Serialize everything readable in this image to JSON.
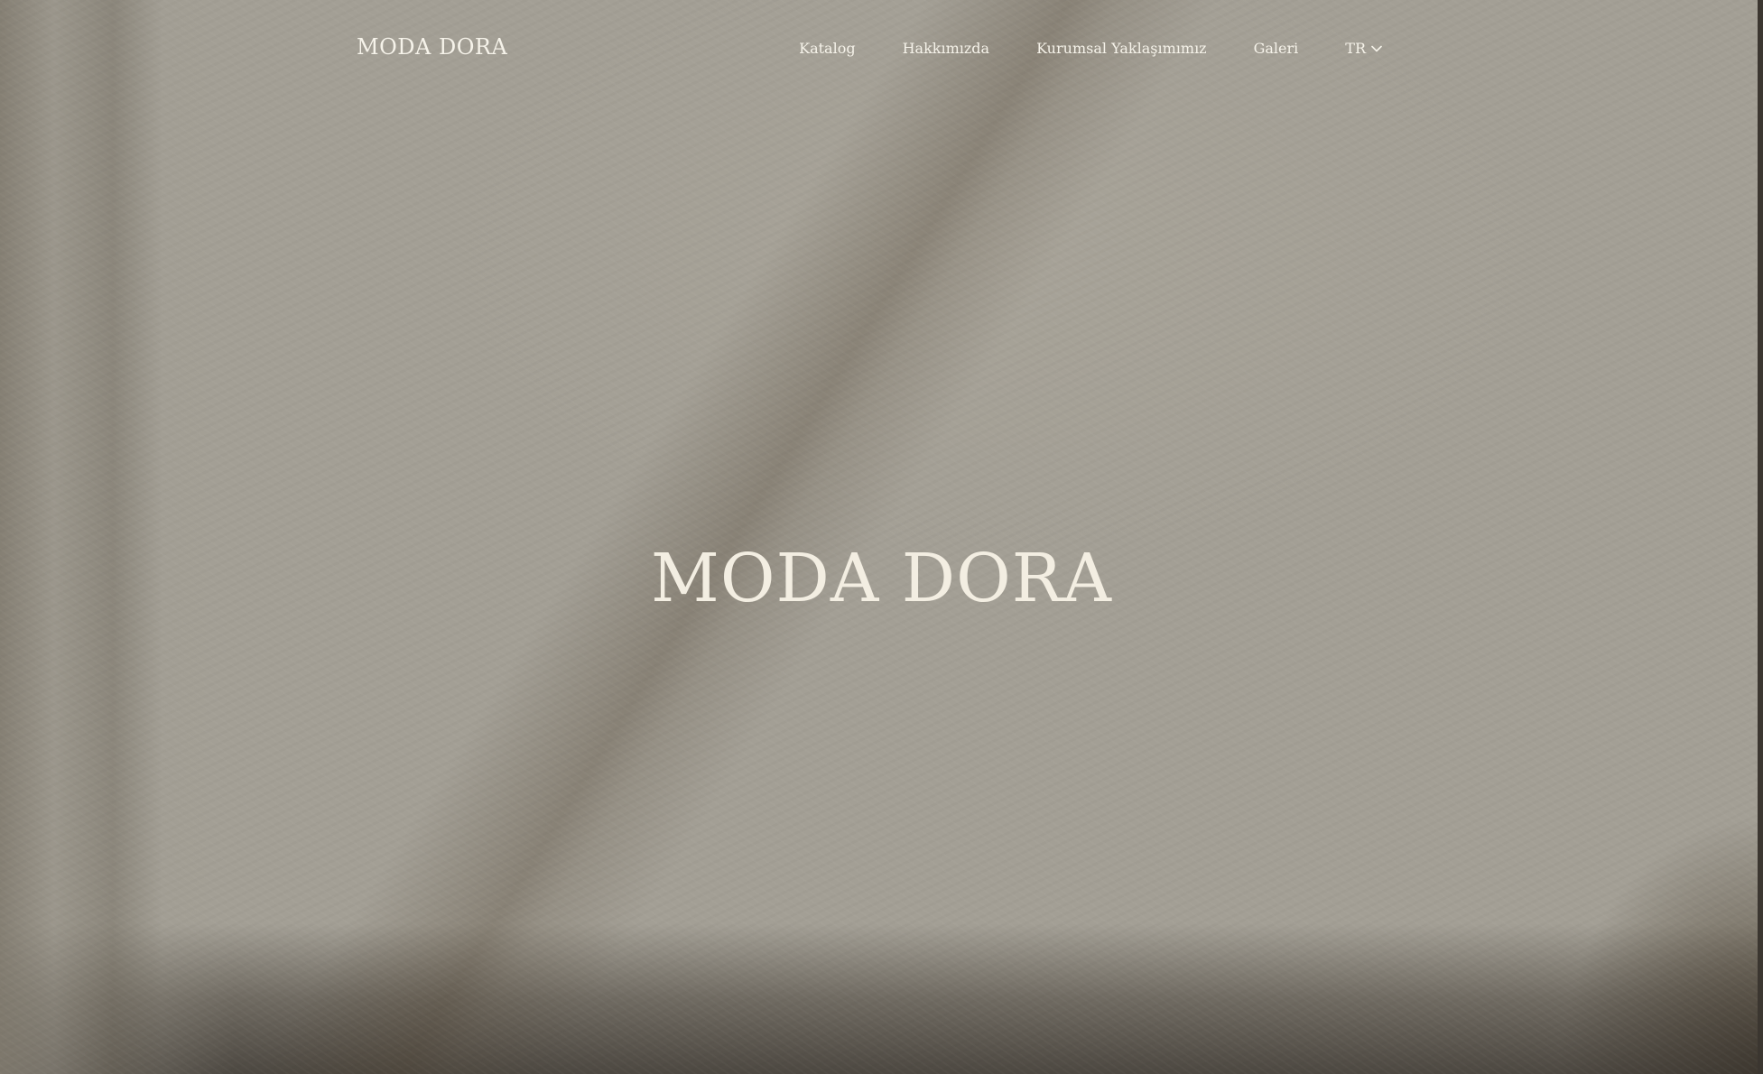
{
  "header": {
    "brand": "MODA DORA",
    "nav": [
      {
        "label": "Katalog"
      },
      {
        "label": "Hakkımızda"
      },
      {
        "label": "Kurumsal Yaklaşımımız"
      },
      {
        "label": "Galeri"
      }
    ],
    "language": {
      "selected": "TR",
      "icon": "chevron-down-icon"
    }
  },
  "hero": {
    "title": "MODA DORA"
  },
  "colors": {
    "text": "#f6f3ea",
    "background": "#a39f95"
  }
}
